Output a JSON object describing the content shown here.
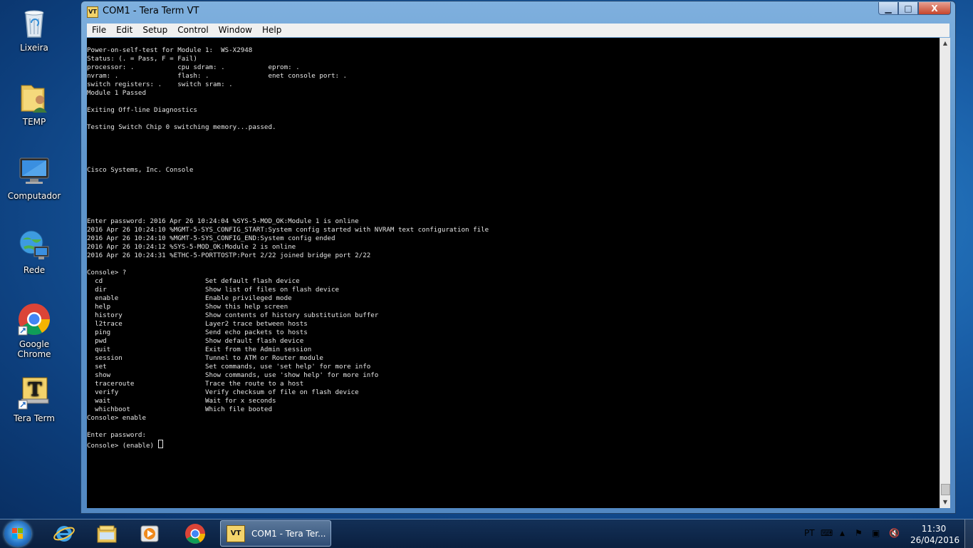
{
  "desktop": {
    "icons": [
      {
        "label": "Lixeira",
        "icon": "recycle-bin-icon"
      },
      {
        "label": "TEMP",
        "icon": "user-folder-icon"
      },
      {
        "label": "Computador",
        "icon": "computer-icon"
      },
      {
        "label": "Rede",
        "icon": "network-icon"
      },
      {
        "label": "Google Chrome",
        "icon": "chrome-icon"
      },
      {
        "label": "Tera Term",
        "icon": "tera-term-icon"
      }
    ]
  },
  "window": {
    "title": "COM1 - Tera Term VT",
    "icon_text": "VT",
    "buttons": {
      "minimize": "▁",
      "maximize": "□",
      "close": "X"
    },
    "menu": [
      "File",
      "Edit",
      "Setup",
      "Control",
      "Window",
      "Help"
    ]
  },
  "terminal": {
    "lines": [
      "Power-on-self-test for Module 1:  WS-X2948",
      "Status: (. = Pass, F = Fail)",
      "processor: .           cpu sdram: .           eprom: .",
      "nvram: .               flash: .               enet console port: .",
      "switch registers: .    switch sram: .",
      "Module 1 Passed",
      "",
      "Exiting Off-line Diagnostics",
      "",
      "Testing Switch Chip 0 switching memory...passed.",
      "",
      "",
      "",
      "",
      "Cisco Systems, Inc. Console",
      "",
      "",
      "",
      "",
      "",
      "Enter password: 2016 Apr 26 10:24:04 %SYS-5-MOD_OK:Module 1 is online",
      "2016 Apr 26 10:24:10 %MGMT-5-SYS_CONFIG_START:System config started with NVRAM text configuration file",
      "2016 Apr 26 10:24:10 %MGMT-5-SYS_CONFIG_END:System config ended",
      "2016 Apr 26 10:24:12 %SYS-5-MOD_OK:Module 2 is online",
      "2016 Apr 26 10:24:31 %ETHC-5-PORTTOSTP:Port 2/22 joined bridge port 2/22",
      "",
      "Console> ?",
      "  cd                          Set default flash device",
      "  dir                         Show list of files on flash device",
      "  enable                      Enable privileged mode",
      "  help                        Show this help screen",
      "  history                     Show contents of history substitution buffer",
      "  l2trace                     Layer2 trace between hosts",
      "  ping                        Send echo packets to hosts",
      "  pwd                         Show default flash device",
      "  quit                        Exit from the Admin session",
      "  session                     Tunnel to ATM or Router module",
      "  set                         Set commands, use 'set help' for more info",
      "  show                        Show commands, use 'show help' for more info",
      "  traceroute                  Trace the route to a host",
      "  verify                      Verify checksum of file on flash device",
      "  wait                        Wait for x seconds",
      "  whichboot                   Which file booted",
      "Console> enable",
      "",
      "Enter password:"
    ],
    "prompt": "Console> (enable) "
  },
  "taskbar": {
    "pinned": [
      "internet-explorer-icon",
      "explorer-icon",
      "media-player-icon",
      "chrome-icon"
    ],
    "active_task": "COM1 - Tera Ter...",
    "active_task_icon": "VT",
    "tray": {
      "language": "PT",
      "time": "11:30",
      "date": "26/04/2016"
    }
  }
}
